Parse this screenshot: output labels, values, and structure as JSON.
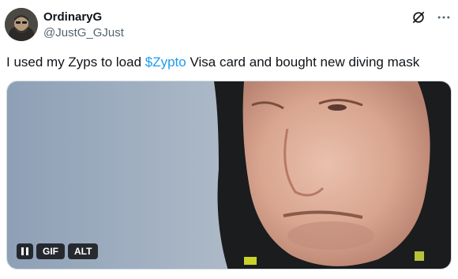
{
  "author": {
    "display_name": "OrdinaryG",
    "handle": "@JustG_GJust"
  },
  "tweet": {
    "text_before": "I used my Zyps to load ",
    "cashtag": "$Zypto",
    "text_after": " Visa card and bought new diving mask"
  },
  "media": {
    "type": "gif",
    "gif_label": "GIF",
    "alt_label": "ALT",
    "state": "playing"
  },
  "icons": {
    "grok": "grok-icon",
    "more": "more-icon",
    "pause": "pause-icon"
  },
  "colors": {
    "link": "#1d9bf0",
    "text": "#0f1419",
    "secondary": "#536471"
  }
}
